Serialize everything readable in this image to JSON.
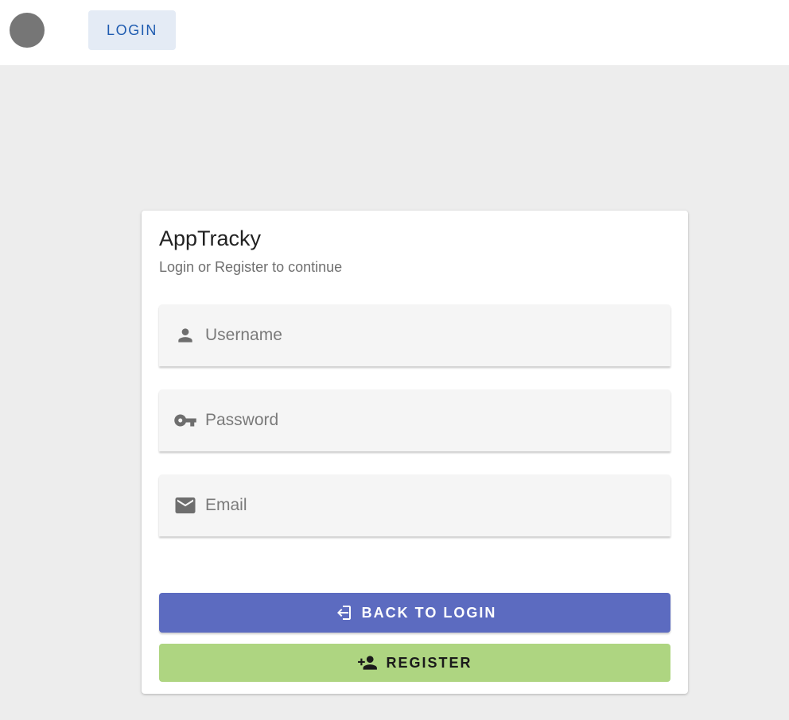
{
  "topbar": {
    "avatar_icon": "avatar-circle",
    "login_label": "LOGIN"
  },
  "card": {
    "title": "AppTracky",
    "subtitle": "Login or Register to continue",
    "fields": [
      {
        "icon": "person-icon",
        "placeholder": "Username",
        "value": ""
      },
      {
        "icon": "key-icon",
        "placeholder": "Password",
        "value": ""
      },
      {
        "icon": "email-icon",
        "placeholder": "Email",
        "value": ""
      }
    ],
    "back_button_label": "BACK TO LOGIN",
    "register_button_label": "REGISTER"
  },
  "colors": {
    "background": "#ededed",
    "primary": "#5c6bc0",
    "register": "#aed581",
    "nav_login_text": "#1e5bb0"
  }
}
